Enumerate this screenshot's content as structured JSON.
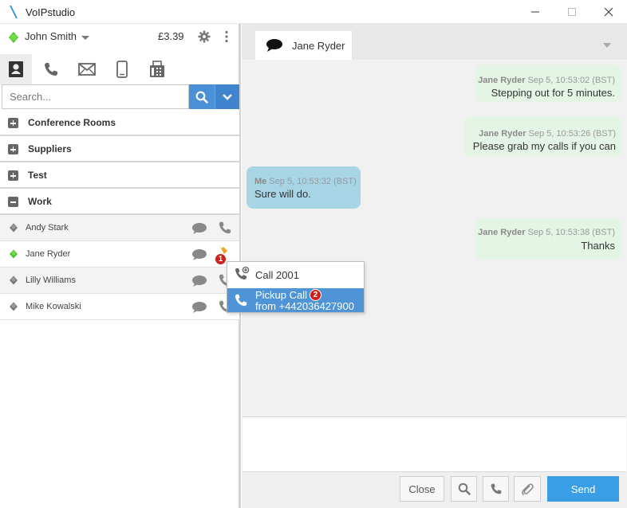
{
  "window": {
    "title": "VoIPstudio",
    "minimize_label": "—",
    "maximize_label": "☐",
    "close_label": "✕"
  },
  "user": {
    "name": "John Smith",
    "balance": "£3.39",
    "status_color": "#4cc22a"
  },
  "tabs": [
    {
      "icon": "contacts-icon",
      "active": true
    },
    {
      "icon": "phone-icon",
      "active": false
    },
    {
      "icon": "mail-icon",
      "active": false
    },
    {
      "icon": "mobile-icon",
      "active": false
    },
    {
      "icon": "fax-icon",
      "active": false
    }
  ],
  "search": {
    "placeholder": "Search..."
  },
  "groups": [
    {
      "label": "Conference Rooms",
      "expanded": false
    },
    {
      "label": "Suppliers",
      "expanded": false
    },
    {
      "label": "Test",
      "expanded": false
    },
    {
      "label": "Work",
      "expanded": true
    }
  ],
  "contacts": [
    {
      "name": "Andy Stark",
      "status": "offline"
    },
    {
      "name": "Jane Ryder",
      "status": "online",
      "badge": "1"
    },
    {
      "name": "Lilly Williams",
      "status": "offline"
    },
    {
      "name": "Mike Kowalski",
      "status": "offline"
    }
  ],
  "context_menu": {
    "call_label": "Call 2001",
    "pickup_label": "Pickup Call",
    "pickup_from": "from +442036427900",
    "pickup_badge": "2"
  },
  "chat": {
    "contact_name": "Jane Ryder",
    "messages": [
      {
        "sender": "Jane Ryder",
        "time": "Sep 5, 10:53:02 (BST)",
        "text": "Stepping out for 5 minutes.",
        "direction": "in"
      },
      {
        "sender": "Jane Ryder",
        "time": "Sep 5, 10:53:26 (BST)",
        "text": "Please grab my calls if you can",
        "direction": "in"
      },
      {
        "sender": "Me",
        "time": "Sep 5, 10:53:32 (BST)",
        "text": "Sure will do.",
        "direction": "out"
      },
      {
        "sender": "Jane Ryder",
        "time": "Sep 5, 10:53:38 (BST)",
        "text": "Thanks",
        "direction": "in"
      }
    ]
  },
  "actions": {
    "close_label": "Close",
    "send_label": "Send"
  },
  "colors": {
    "accent": "#4a90d6",
    "send": "#3a9ee6",
    "online": "#4cc22a",
    "offline": "#777777",
    "badge": "#d0201c"
  }
}
